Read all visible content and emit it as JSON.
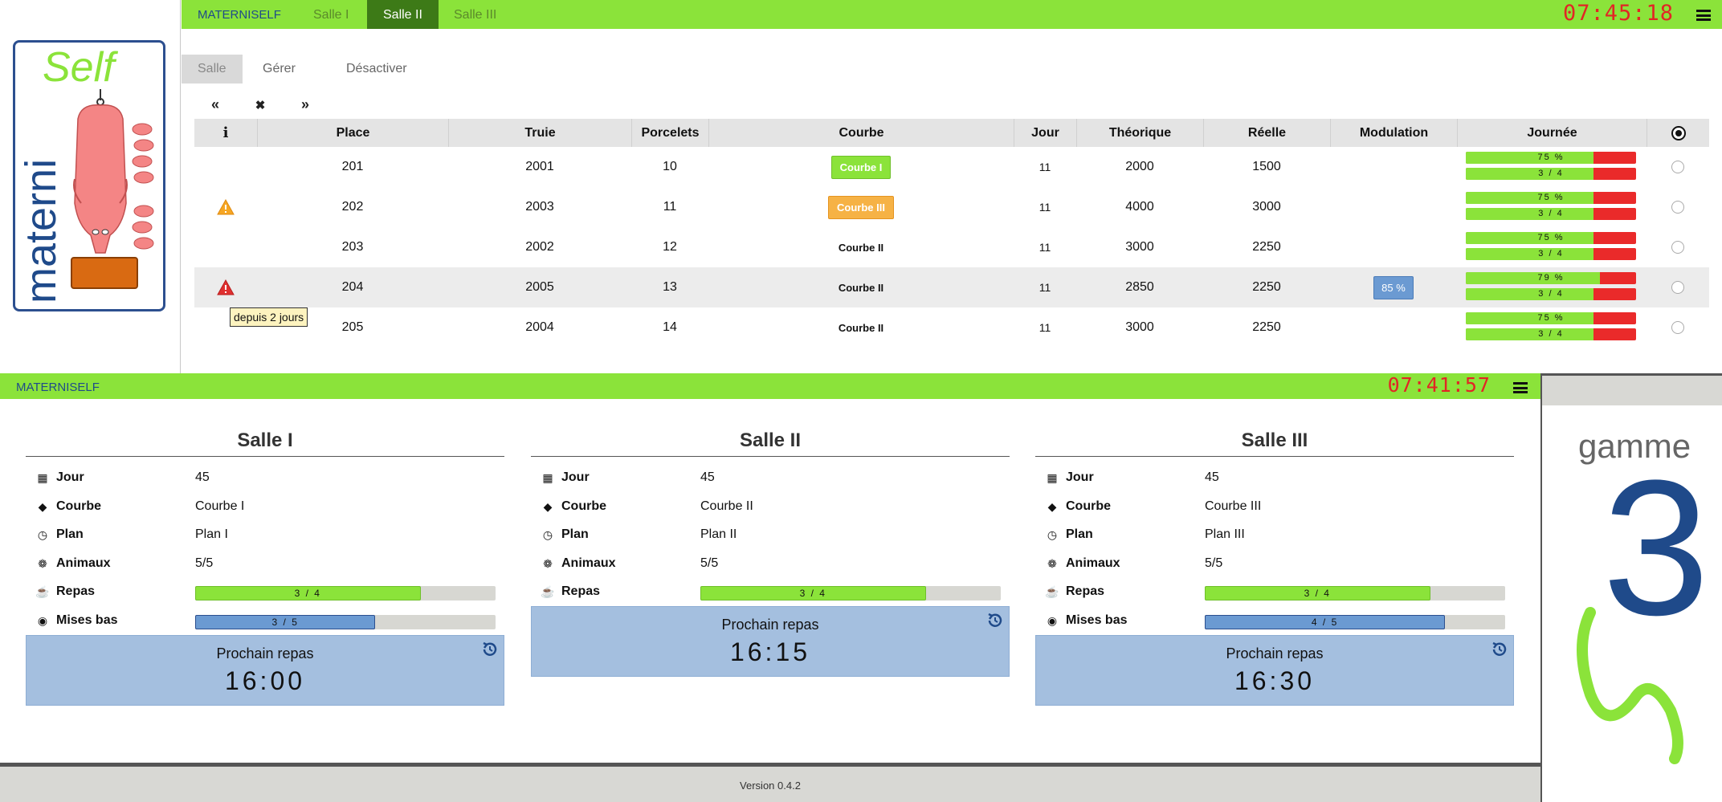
{
  "top": {
    "brand": "MATERNISELF",
    "tabs": [
      {
        "label": "Salle I"
      },
      {
        "label": "Salle II"
      },
      {
        "label": "Salle III"
      }
    ],
    "clock": "07:45:18",
    "logo": {
      "top_word": "Self",
      "side_word": "materni"
    },
    "subtabs": [
      {
        "label": "Salle"
      },
      {
        "label": "Gérer"
      },
      {
        "label": "Désactiver"
      }
    ],
    "pager": {
      "prev": "«",
      "close": "✖",
      "next": "»"
    },
    "columns": {
      "info": "i",
      "place": "Place",
      "truie": "Truie",
      "porcelets": "Porcelets",
      "courbe": "Courbe",
      "jour": "Jour",
      "theorique": "Théorique",
      "reelle": "Réelle",
      "modulation": "Modulation",
      "journee": "Journée"
    },
    "rows": [
      {
        "place": "201",
        "truie": "2001",
        "porcelets": "10",
        "courbe": "Courbe I",
        "jour": "11",
        "theorique": "2000",
        "reelle": "1500",
        "modulation": "",
        "bar1": "75 %",
        "bar1_fraction": 0.75,
        "bar2": "3 / 4",
        "bar2_fraction": 0.75
      },
      {
        "place": "202",
        "truie": "2003",
        "porcelets": "11",
        "courbe": "Courbe III",
        "jour": "11",
        "theorique": "4000",
        "reelle": "3000",
        "modulation": "",
        "bar1": "75 %",
        "bar1_fraction": 0.75,
        "bar2": "3 / 4",
        "bar2_fraction": 0.75
      },
      {
        "place": "203",
        "truie": "2002",
        "porcelets": "12",
        "courbe": "Courbe II",
        "jour": "11",
        "theorique": "3000",
        "reelle": "2250",
        "modulation": "",
        "bar1": "75 %",
        "bar1_fraction": 0.75,
        "bar2": "3 / 4",
        "bar2_fraction": 0.75
      },
      {
        "place": "204",
        "truie": "2005",
        "porcelets": "13",
        "courbe": "Courbe II",
        "jour": "11",
        "theorique": "2850",
        "reelle": "2250",
        "modulation": "85 %",
        "bar1": "79 %",
        "bar1_fraction": 0.79,
        "bar2": "3 / 4",
        "bar2_fraction": 0.75
      },
      {
        "place": "205",
        "truie": "2004",
        "porcelets": "14",
        "courbe": "Courbe II",
        "jour": "11",
        "theorique": "3000",
        "reelle": "2250",
        "modulation": "",
        "bar1": "75 %",
        "bar1_fraction": 0.75,
        "bar2": "3 / 4",
        "bar2_fraction": 0.75
      }
    ],
    "tooltip": "depuis 2 jours",
    "colors": {
      "nav_green": "#8be33a",
      "active_tab": "#3d7a17",
      "clock_red": "#e22525",
      "warning_orange": "#f6a623",
      "alert_red": "#e03030"
    }
  },
  "bottom": {
    "brand": "MATERNISELF",
    "clock": "07:41:57",
    "labels": {
      "jour": "Jour",
      "courbe": "Courbe",
      "plan": "Plan",
      "animaux": "Animaux",
      "repas": "Repas",
      "mises_bas": "Mises bas",
      "prochain": "Prochain repas"
    },
    "salles": [
      {
        "title": "Salle I",
        "jour": "45",
        "courbe": "Courbe I",
        "plan": "Plan I",
        "animaux": "5/5",
        "repas": "3 / 4",
        "repas_fraction": 0.75,
        "mises_bas": "3 / 5",
        "mises_bas_fraction": 0.6,
        "prochain_repas": "16:00"
      },
      {
        "title": "Salle II",
        "jour": "45",
        "courbe": "Courbe II",
        "plan": "Plan II",
        "animaux": "5/5",
        "repas": "3 / 4",
        "repas_fraction": 0.75,
        "prochain_repas": "16:15"
      },
      {
        "title": "Salle III",
        "jour": "45",
        "courbe": "Courbe III",
        "plan": "Plan III",
        "animaux": "5/5",
        "repas": "3 / 4",
        "repas_fraction": 0.75,
        "mises_bas": "4 / 5",
        "mises_bas_fraction": 0.8,
        "prochain_repas": "16:30"
      }
    ],
    "version": "Version 0.4.2",
    "gamme": {
      "word": "gamme",
      "numeral": "3",
      "letter": "S"
    },
    "colors": {
      "repas_bar": "#8be33a",
      "mises_bas_bar": "#6b9ad2",
      "next_meal_box": "#a4bfdf",
      "gamme_blue": "#1f4a8a"
    }
  }
}
